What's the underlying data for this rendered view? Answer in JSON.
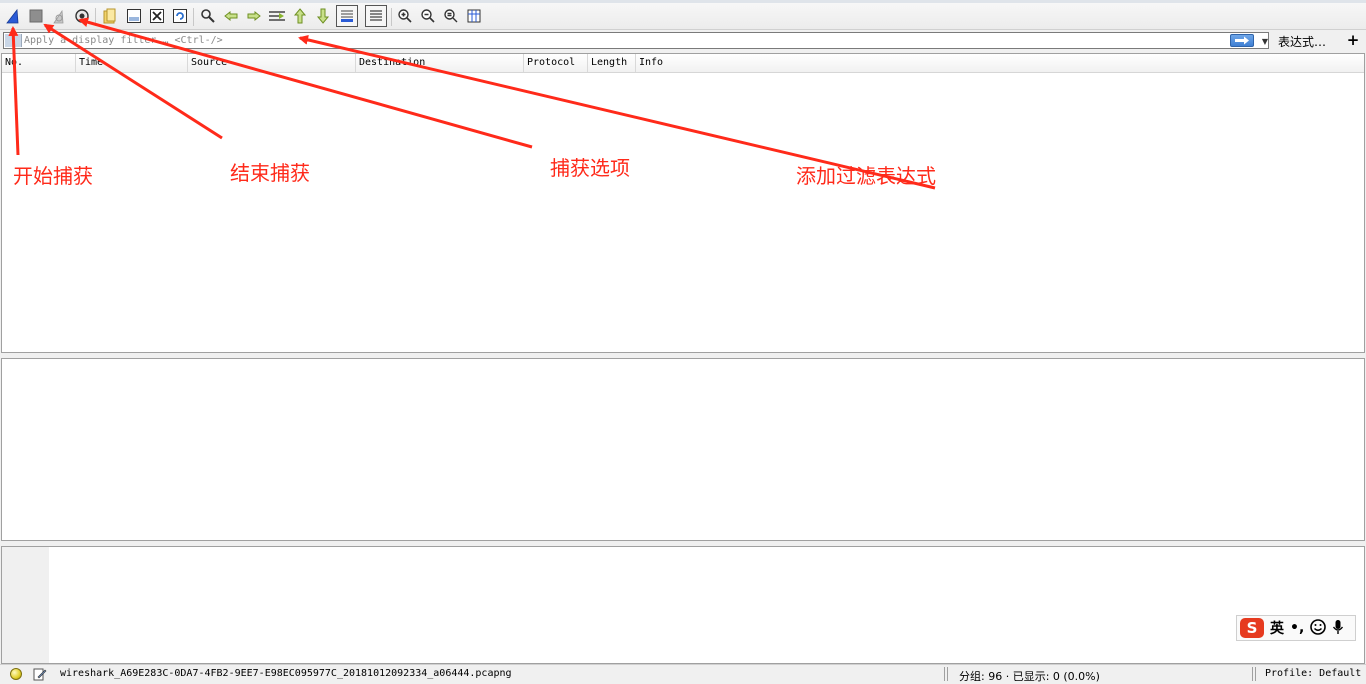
{
  "toolbar": {
    "icons": [
      "shark-fin-start-icon",
      "stop-square-icon",
      "restart-fin-icon",
      "gear-options-icon",
      "open-folder-icon",
      "save-file-icon",
      "close-file-icon",
      "reload-icon",
      "find-packet-icon",
      "go-back-icon",
      "go-forward-icon",
      "go-to-packet-icon",
      "go-first-icon",
      "go-last-icon",
      "autoscroll-icon",
      "colorize-icon",
      "zoom-in-icon",
      "zoom-out-icon",
      "normal-size-icon",
      "resize-columns-icon"
    ]
  },
  "filter": {
    "placeholder": "Apply a display filter … <Ctrl-/>",
    "expression_label": "表达式…",
    "plus_label": "+"
  },
  "packet_list": {
    "columns": [
      "No.",
      "Time",
      "Source",
      "Destination",
      "Protocol",
      "Length",
      "Info"
    ]
  },
  "status": {
    "filename": "wireshark_A69E283C-0DA7-4FB2-9EE7-E98EC095977C_20181012092334_a06444.pcapng",
    "packets": "分组: 96 · 已显示: 0 (0.0%)",
    "profile": "Profile: Default"
  },
  "ime": {
    "logo": "S",
    "mode": "英",
    "punct": "•,"
  },
  "annotations": {
    "start_capture": "开始捕获",
    "stop_capture": "结束捕获",
    "capture_options": "捕获选项",
    "add_filter_expression": "添加过滤表达式"
  },
  "colors": {
    "annotation": "#ff2a1a",
    "apply_arrow": "#3f7fd3"
  }
}
